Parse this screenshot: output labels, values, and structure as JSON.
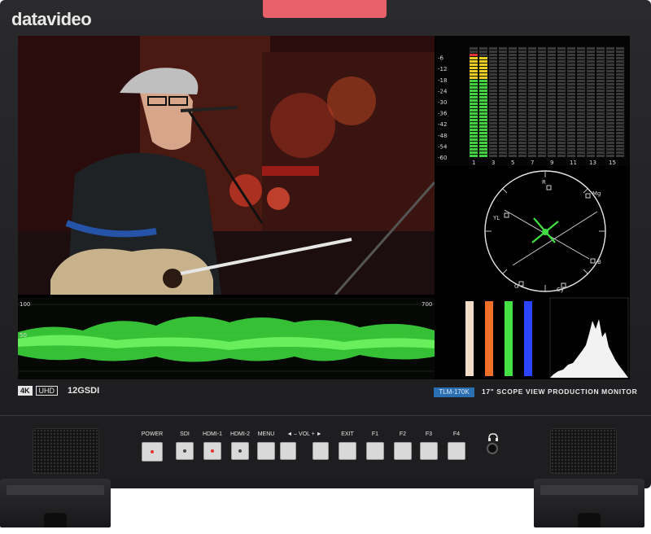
{
  "brand": "datavideo",
  "meters": {
    "scale": [
      "-6",
      "-12",
      "-18",
      "-24",
      "-30",
      "-36",
      "-42",
      "-48",
      "-54",
      "-60"
    ],
    "channels": [
      "1",
      "3",
      "5",
      "7",
      "9",
      "11",
      "13",
      "15"
    ],
    "levels": [
      0.93,
      0.92
    ]
  },
  "waveform": {
    "top_label": "700",
    "mid_label": "50",
    "left_top": "100"
  },
  "vectorscope": {
    "labels": [
      "R",
      "Mg",
      "YL",
      "B",
      "G",
      "Cy"
    ]
  },
  "badges": {
    "k4": "4K",
    "uhd": "UHD",
    "sdi": "12GSDI"
  },
  "model": {
    "badge": "TLM-170K",
    "title": "17\" SCOPE VIEW PRODUCTION MONITOR"
  },
  "controls": {
    "power": "POWER",
    "sdi": "SDI",
    "hdmi1": "HDMI-1",
    "hdmi2": "HDMI-2",
    "menu": "MENU",
    "vol": "◄ – VOL + ►",
    "exit": "EXIT",
    "f1": "F1",
    "f2": "F2",
    "f3": "F3",
    "f4": "F4"
  },
  "colors": {
    "accent_red": "#e8606a",
    "model_blue": "#2b6fb3",
    "scope_green": "#3fe03f"
  }
}
